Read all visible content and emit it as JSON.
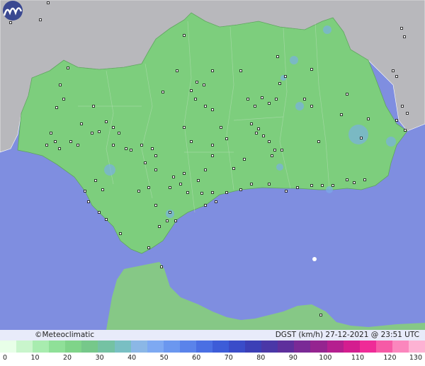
{
  "map": {
    "credit": "©Meteoclimatic",
    "title": "DGST (km/h)  27-12-2021 @ 23:51 UTC",
    "colors": {
      "sea": "#7f8ee0",
      "land_outside": "#b8b8bc",
      "region": "#7dce7d",
      "morocco": "#86c886"
    }
  },
  "legend": {
    "ticks": [
      "0",
      "10",
      "20",
      "30",
      "40",
      "50",
      "60",
      "70",
      "80",
      "90",
      "100",
      "110",
      "120",
      "130"
    ],
    "colors": [
      "#e8ffe8",
      "#c9f5cc",
      "#a8ecaf",
      "#8fe098",
      "#7fd489",
      "#76c88a",
      "#74c2a3",
      "#79bfc3",
      "#8bb7e6",
      "#7ea9f2",
      "#6b97ef",
      "#5a83ea",
      "#4a6fe3",
      "#3d5cd8",
      "#3a4cc9",
      "#3c3fb6",
      "#4a37a7",
      "#5e2f9c",
      "#7a2a96",
      "#952490",
      "#b51f8f",
      "#d41d8f",
      "#ef2b97",
      "#f65aa6",
      "#fb86bd",
      "#fdb2d3"
    ]
  },
  "stations_note": "",
  "gust_spots_note": ""
}
